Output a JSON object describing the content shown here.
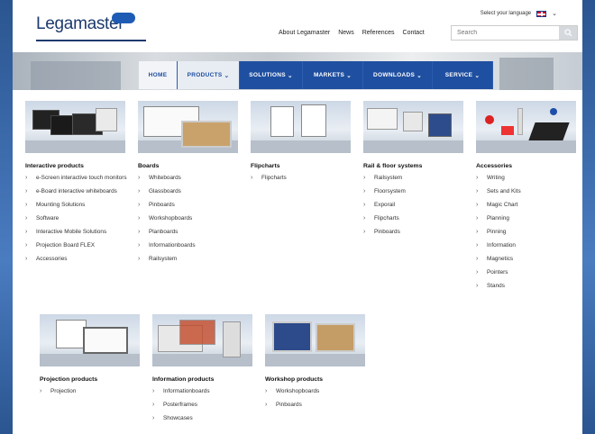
{
  "colors": {
    "brand": "#1e3a6e",
    "nav": "#1f4fa0",
    "bg": "#2f5d9a"
  },
  "header": {
    "logo": "Legamaster",
    "language_label": "Select your language",
    "links": [
      "About Legamaster",
      "News",
      "References",
      "Contact"
    ],
    "search_placeholder": "Search"
  },
  "nav": {
    "items": [
      "HOME",
      "PRODUCTS",
      "SOLUTIONS",
      "MARKETS",
      "DOWNLOADS",
      "SERVICE"
    ],
    "active": "PRODUCTS"
  },
  "categories": [
    {
      "title": "Interactive products",
      "items": [
        "e-Screen interactive touch monitors",
        "e-Board interactive whiteboards",
        "Mounting Solutions",
        "Software",
        "Interactive Mobile Solutions",
        "Projection Board FLEX",
        "Accessories"
      ]
    },
    {
      "title": "Boards",
      "items": [
        "Whiteboards",
        "Glassboards",
        "Pinboards",
        "Workshopboards",
        "Planboards",
        "Informationboards",
        "Railsystem"
      ]
    },
    {
      "title": "Flipcharts",
      "items": [
        "Flipcharts"
      ]
    },
    {
      "title": "Rail & floor systems",
      "items": [
        "Railsystem",
        "Floorsystem",
        "Exporail",
        "Flipcharts",
        "Pinboards"
      ]
    },
    {
      "title": "Accessories",
      "items": [
        "Writing",
        "Sets and Kits",
        "Magic Chart",
        "Planning",
        "Pinning",
        "Information",
        "Magnetics",
        "Pointers",
        "Stands"
      ]
    },
    {
      "title": "Projection products",
      "items": [
        "Projection"
      ]
    },
    {
      "title": "Information products",
      "items": [
        "Informationboards",
        "Posterframes",
        "Showcases"
      ]
    },
    {
      "title": "Workshop products",
      "items": [
        "Workshopboards",
        "Pinboards"
      ]
    }
  ]
}
